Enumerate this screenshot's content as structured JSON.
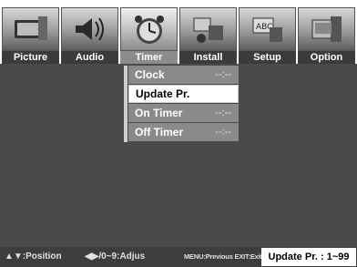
{
  "tabs": [
    {
      "label": "Picture",
      "icon": "picture-icon",
      "active": false
    },
    {
      "label": "Audio",
      "icon": "audio-icon",
      "active": false
    },
    {
      "label": "Timer",
      "icon": "timer-icon",
      "active": true
    },
    {
      "label": "Install",
      "icon": "install-icon",
      "active": false
    },
    {
      "label": "Setup",
      "icon": "setup-icon",
      "active": false
    },
    {
      "label": "Option",
      "icon": "option-icon",
      "active": false
    }
  ],
  "menu": {
    "items": [
      {
        "label": "Clock",
        "value": "--:--",
        "selected": false
      },
      {
        "label": "Update Pr.",
        "value": "",
        "selected": true
      },
      {
        "label": "On Timer",
        "value": "--:--",
        "selected": false
      },
      {
        "label": "Off Timer",
        "value": "--:--",
        "selected": false
      }
    ]
  },
  "status": {
    "position_hint": "▲▼:Position",
    "adjust_hint": "◀▶/0~9:Adjus",
    "nav_hint": "MENU:Previous  EXIT:Exit",
    "help": "Update Pr. : 1~99"
  },
  "colors": {
    "background": "#4a4a4a",
    "menu_item": "#8a8a8a",
    "menu_selected": "#ffffff",
    "status_bar": "#3d3d3d"
  }
}
